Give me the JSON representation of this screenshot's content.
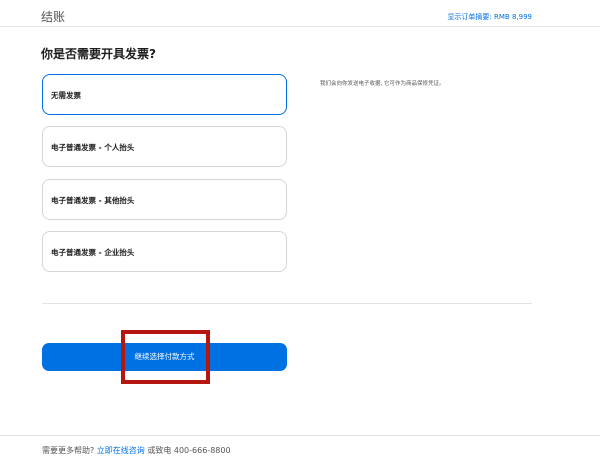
{
  "header": {
    "title": "结账",
    "summary": "显示订单摘要: RMB 8,999"
  },
  "question": "你是否需要开具发票?",
  "options": [
    {
      "label": "无需发票",
      "selected": true
    },
    {
      "label": "电子普通发票 - 个人抬头",
      "selected": false
    },
    {
      "label": "电子普通发票 - 其他抬头",
      "selected": false
    },
    {
      "label": "电子普通发票 - 企业抬头",
      "selected": false
    }
  ],
  "note": "我们会向你发送电子收据, 它可作为商品保修凭证。",
  "continue_label": "继续选择付款方式",
  "footer": {
    "prefix": "需要更多帮助? ",
    "link": "立即在线咨询",
    "suffix": " 或致电 400-666-8800"
  },
  "colors": {
    "accent": "#0071e3",
    "highlight": "#b5170f"
  }
}
